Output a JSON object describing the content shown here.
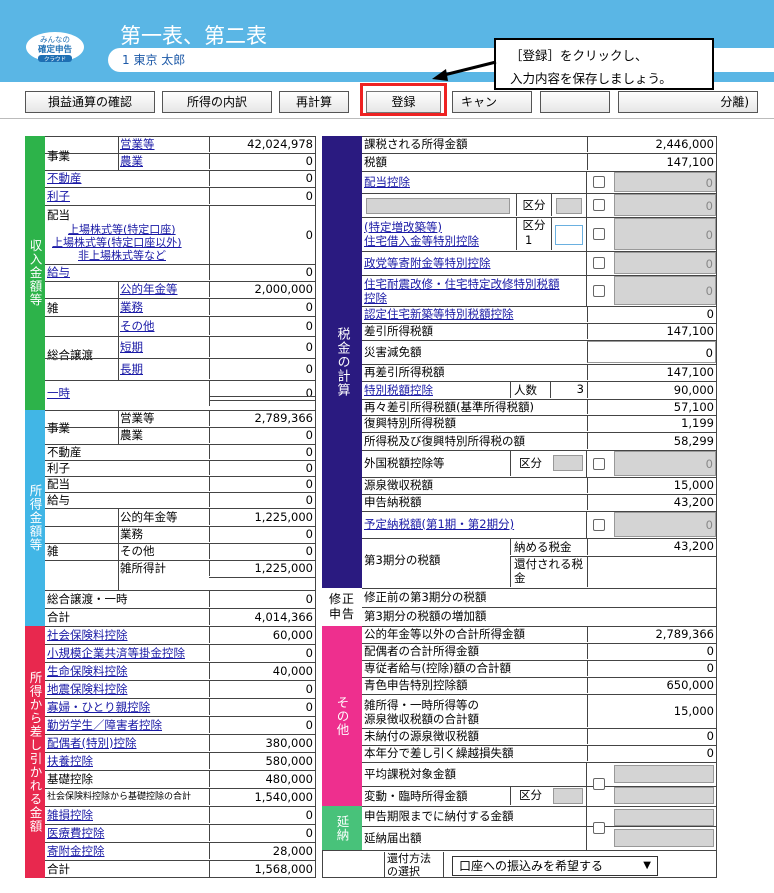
{
  "app": {
    "logo_text": "みんなの\n確定申告\nクラウド",
    "title": "第一表、第二表",
    "user": "1 東京 太郎"
  },
  "callout": {
    "line1": "［登録］をクリックし、",
    "line2": "入力内容を保存しましょう。"
  },
  "toolbar": {
    "b1": "損益通算の確認",
    "b2": "所得の内訳",
    "b3": "再計算",
    "b4": "登録",
    "b5": "キャン",
    "b6": "分離)"
  },
  "left": {
    "bar1": "収入金額等",
    "bar2": "所得金額等",
    "bar3": "所得から差し引かれる金額",
    "r_jigyo": "事業",
    "r_eigyo": "営業等",
    "v_eigyo": "42,024,978",
    "r_nogyo": "農業",
    "v_nogyo": "0",
    "r_fudosan": "不動産",
    "v_fudosan": "0",
    "r_rishi": "利子",
    "v_rishi": "0",
    "r_haito": "配当",
    "r_h1": "上場株式等(特定口座)",
    "r_h2": "上場株式等(特定口座以外)",
    "r_h3": "非上場株式等など",
    "v_haito": "0",
    "r_kyuyo": "給与",
    "v_kyuyo": "0",
    "r_zatsu": "雑",
    "r_nenkin": "公的年金等",
    "v_nenkin": "2,000,000",
    "r_gyomu": "業務",
    "v_gyomu": "0",
    "r_sonota": "その他",
    "v_sonota": "0",
    "r_sogo": "総合譲渡",
    "r_tanki": "短期",
    "v_tanki": "0",
    "r_choki": "長期",
    "v_choki": "0",
    "r_ichiji": "一時",
    "v_ichiji": "0",
    "s_jigyo": "事業",
    "s_eigyo": "営業等",
    "sv_eigyo": "2,789,366",
    "s_nogyo": "農業",
    "sv_nogyo": "0",
    "s_fudosan": "不動産",
    "sv_fudosan": "0",
    "s_rishi": "利子",
    "sv_rishi": "0",
    "s_haito": "配当",
    "sv_haito": "0",
    "s_kyuyo": "給与",
    "sv_kyuyo": "0",
    "s_zatsu": "雑",
    "s_nenkin": "公的年金等",
    "sv_nenkin": "1,225,000",
    "s_gyomu": "業務",
    "sv_gyomu": "0",
    "s_sonota": "その他",
    "sv_sonota": "0",
    "s_zatsukei": "雑所得計",
    "sv_zatsukei": "1,225,000",
    "s_sogo": "総合譲渡・一時",
    "sv_sogo": "0",
    "s_total": "合計",
    "sv_total": "4,014,366",
    "d_shakai": "社会保険料控除",
    "dv_shakai": "60,000",
    "d_shokibo": "小規模企業共済等掛金控除",
    "dv_shokibo": "0",
    "d_seimei": "生命保険料控除",
    "dv_seimei": "40,000",
    "d_jishin": "地震保険料控除",
    "dv_jishin": "0",
    "d_kafu": "寡婦・ひとり親控除",
    "dv_kafu": "0",
    "d_kinro": "勤労学生／障害者控除",
    "dv_kinro": "0",
    "d_haigu": "配偶者(特別)控除",
    "dv_haigu": "380,000",
    "d_fuyo": "扶養控除",
    "dv_fuyo": "580,000",
    "d_kiso": "基礎控除",
    "dv_kiso": "480,000",
    "d_subtotal": "社会保険料控除から基礎控除の合計",
    "dv_subtotal": "1,540,000",
    "d_zasson": "雑損控除",
    "dv_zasson": "0",
    "d_iryo": "医療費控除",
    "dv_iryo": "0",
    "d_kifu": "寄附金控除",
    "dv_kifu": "28,000",
    "d_total": "合計",
    "dv_total": "1,568,000"
  },
  "right": {
    "bar_tax": "税金の計算",
    "bar_shusei": "修正申告",
    "bar_other": "その他",
    "bar_ennou": "延納",
    "t1": "課税される所得金額",
    "v1": "2,446,000",
    "t2": "税額",
    "v2": "147,100",
    "t3": "配当控除",
    "v3": "0",
    "t4_kubun": "区分",
    "v4": "0",
    "t5a": "(特定増改築等)",
    "t5b": "住宅借入金等特別控除",
    "t5_kubun": "区分",
    "t5_kubun_val": "1",
    "v5": "0",
    "t6": "政党等寄附金等特別控除",
    "v6": "0",
    "t7a": "住宅耐震改修・住宅特定改修特別税額",
    "t7b": "控除",
    "v7": "0",
    "t8": "認定住宅新築等特別税額控除",
    "v8": "0",
    "t9": "差引所得税額",
    "v9": "147,100",
    "t10": "災害減免額",
    "v10": "0",
    "t11": "再差引所得税額",
    "v11": "147,100",
    "t12": "特別税額控除",
    "t12_ninzu": "人数",
    "t12_ninzu_val": "3",
    "v12": "90,000",
    "t13": "再々差引所得税額(基準所得税額)",
    "v13": "57,100",
    "t14": "復興特別所得税額",
    "v14": "1,199",
    "t15": "所得税及び復興特別所得税の額",
    "v15": "58,299",
    "t16": "外国税額控除等",
    "t16_kubun": "区分",
    "v16": "0",
    "t17": "源泉徴収税額",
    "v17": "15,000",
    "t18": "申告納税額",
    "v18": "43,200",
    "t19": "予定納税額(第1期・第2期分)",
    "v19": "0",
    "t20": "第3期分の税額",
    "t20_pay": "納める税金",
    "v20_pay": "43,200",
    "t20_refund": "還付される税金",
    "t21": "修正前の第3期分の税額",
    "t22": "第3期分の税額の増加額",
    "o1": "公的年金等以外の合計所得金額",
    "ov1": "2,789,366",
    "o2": "配偶者の合計所得金額",
    "ov2": "0",
    "o3": "専従者給与(控除)額の合計額",
    "ov3": "0",
    "o4": "青色申告特別控除額",
    "ov4": "650,000",
    "o5a": "雑所得・一時所得等の",
    "o5b": "源泉徴収税額の合計額",
    "ov5": "15,000",
    "o6": "未納付の源泉徴収税額",
    "ov6": "0",
    "o7": "本年分で差し引く繰越損失額",
    "ov7": "0",
    "o8": "平均課税対象金額",
    "o9": "変動・臨時所得金額",
    "o9_kubun": "区分",
    "e1": "申告期限までに納付する金額",
    "e2": "延納届出額",
    "refund_label_a": "還付方法",
    "refund_label_b": "の選択",
    "refund_select": "口座への振込みを希望する"
  }
}
